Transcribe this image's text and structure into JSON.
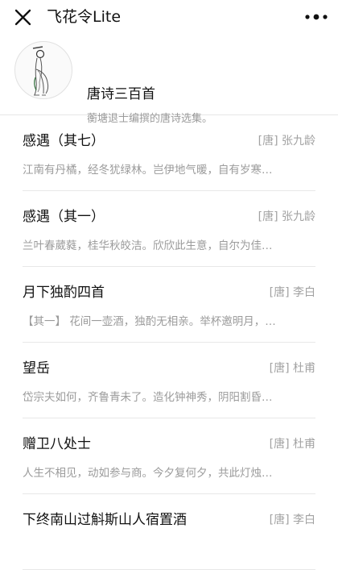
{
  "nav": {
    "title": "飞花令Lite",
    "close_icon": "close-icon",
    "more_icon": "more-icon"
  },
  "book": {
    "name": "唐诗三百首",
    "description": "蘅塘退士编撰的唐诗选集。"
  },
  "poems": [
    {
      "title": "感遇（其七）",
      "author": "[唐] 张九龄",
      "excerpt": "江南有丹橘，经冬犹绿林。岂伊地气暖，自有岁寒…"
    },
    {
      "title": "感遇（其一）",
      "author": "[唐] 张九龄",
      "excerpt": "兰叶春葳蕤，桂华秋皎洁。欣欣此生意，自尔为佳…"
    },
    {
      "title": "月下独酌四首",
      "author": "[唐] 李白",
      "excerpt": "【其一】 花间一壶酒，独酌无相亲。举杯邀明月，…"
    },
    {
      "title": "望岳",
      "author": "[唐] 杜甫",
      "excerpt": "岱宗夫如何，齐鲁青未了。造化钟神秀，阴阳割昏…"
    },
    {
      "title": "赠卫八处士",
      "author": "[唐] 杜甫",
      "excerpt": "人生不相见，动如参与商。今夕复何夕，共此灯烛…"
    },
    {
      "title": "下终南山过斛斯山人宿置酒",
      "author": "[唐] 李白",
      "excerpt": ""
    }
  ]
}
